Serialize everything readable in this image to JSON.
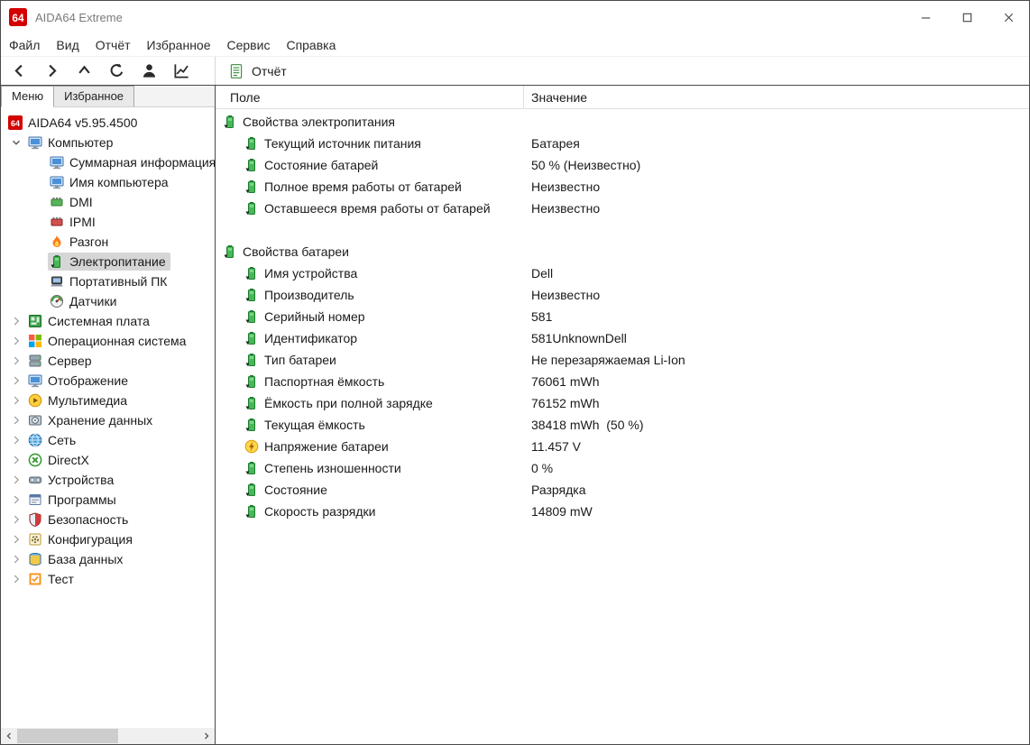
{
  "window": {
    "title": "AIDA64 Extreme",
    "logo_text": "64"
  },
  "menubar": {
    "items": [
      "Файл",
      "Вид",
      "Отчёт",
      "Избранное",
      "Сервис",
      "Справка"
    ]
  },
  "toolbar": {
    "report_label": "Отчёт",
    "icons": [
      "back-icon",
      "forward-icon",
      "up-icon",
      "refresh-icon",
      "user-icon",
      "chart-icon",
      "report-icon"
    ]
  },
  "sidebar": {
    "tabs": [
      {
        "label": "Меню",
        "active": true
      },
      {
        "label": "Избранное",
        "active": false
      }
    ]
  },
  "tree": [
    {
      "label": "AIDA64 v5.95.4500",
      "icon": "aida",
      "level": 0,
      "chevron": "hidden"
    },
    {
      "label": "Компьютер",
      "icon": "computer",
      "level": 0,
      "chevron": "down"
    },
    {
      "label": "Суммарная информация",
      "icon": "summary",
      "level": 1,
      "chevron": "blank"
    },
    {
      "label": "Имя компьютера",
      "icon": "computer-name",
      "level": 1,
      "chevron": "blank"
    },
    {
      "label": "DMI",
      "icon": "dmi",
      "level": 1,
      "chevron": "blank"
    },
    {
      "label": "IPMI",
      "icon": "ipmi",
      "level": 1,
      "chevron": "blank"
    },
    {
      "label": "Разгон",
      "icon": "overclock",
      "level": 1,
      "chevron": "blank"
    },
    {
      "label": "Электропитание",
      "icon": "power",
      "level": 1,
      "chevron": "blank",
      "selected": true
    },
    {
      "label": "Портативный ПК",
      "icon": "laptop",
      "level": 1,
      "chevron": "blank"
    },
    {
      "label": "Датчики",
      "icon": "sensors",
      "level": 1,
      "chevron": "blank"
    },
    {
      "label": "Системная плата",
      "icon": "motherboard",
      "level": 0,
      "chevron": "right"
    },
    {
      "label": "Операционная система",
      "icon": "os",
      "level": 0,
      "chevron": "right"
    },
    {
      "label": "Сервер",
      "icon": "server",
      "level": 0,
      "chevron": "right"
    },
    {
      "label": "Отображение",
      "icon": "display",
      "level": 0,
      "chevron": "right"
    },
    {
      "label": "Мультимедиа",
      "icon": "multimedia",
      "level": 0,
      "chevron": "right"
    },
    {
      "label": "Хранение данных",
      "icon": "storage",
      "level": 0,
      "chevron": "right"
    },
    {
      "label": "Сеть",
      "icon": "network",
      "level": 0,
      "chevron": "right"
    },
    {
      "label": "DirectX",
      "icon": "directx",
      "level": 0,
      "chevron": "right"
    },
    {
      "label": "Устройства",
      "icon": "devices",
      "level": 0,
      "chevron": "right"
    },
    {
      "label": "Программы",
      "icon": "programs",
      "level": 0,
      "chevron": "right"
    },
    {
      "label": "Безопасность",
      "icon": "security",
      "level": 0,
      "chevron": "right"
    },
    {
      "label": "Конфигурация",
      "icon": "config",
      "level": 0,
      "chevron": "right"
    },
    {
      "label": "База данных",
      "icon": "database",
      "level": 0,
      "chevron": "right"
    },
    {
      "label": "Тест",
      "icon": "test",
      "level": 0,
      "chevron": "right"
    }
  ],
  "report_table": {
    "field_header": "Поле",
    "value_header": "Значение",
    "groups": [
      {
        "title": "Свойства электропитания",
        "icon": "power",
        "rows": [
          {
            "field": "Текущий источник питания",
            "value": "Батарея",
            "icon": "power"
          },
          {
            "field": "Состояние батарей",
            "value": "50 % (Неизвестно)",
            "icon": "power"
          },
          {
            "field": "Полное время работы от батарей",
            "value": "Неизвестно",
            "icon": "power"
          },
          {
            "field": "Оставшееся время работы от батарей",
            "value": "Неизвестно",
            "icon": "power"
          }
        ]
      },
      {
        "title": "Свойства батареи",
        "icon": "power",
        "rows": [
          {
            "field": "Имя устройства",
            "value": "Dell",
            "icon": "power"
          },
          {
            "field": "Производитель",
            "value": "Неизвестно",
            "icon": "power"
          },
          {
            "field": "Серийный номер",
            "value": "581",
            "icon": "power"
          },
          {
            "field": "Идентификатор",
            "value": "581UnknownDell",
            "icon": "power"
          },
          {
            "field": "Тип батареи",
            "value": "Не перезаряжаемая Li-Ion",
            "icon": "power"
          },
          {
            "field": "Паспортная ёмкость",
            "value": "76061 mWh",
            "icon": "power"
          },
          {
            "field": "Ёмкость при полной зарядке",
            "value": "76152 mWh",
            "icon": "power"
          },
          {
            "field": "Текущая ёмкость",
            "value": "38418 mWh  (50 %)",
            "icon": "power"
          },
          {
            "field": "Напряжение батареи",
            "value": "11.457 V",
            "icon": "voltage"
          },
          {
            "field": "Степень изношенности",
            "value": "0 %",
            "icon": "power"
          },
          {
            "field": "Состояние",
            "value": "Разрядка",
            "icon": "power"
          },
          {
            "field": "Скорость разрядки",
            "value": "14809 mW",
            "icon": "power"
          }
        ]
      }
    ]
  }
}
